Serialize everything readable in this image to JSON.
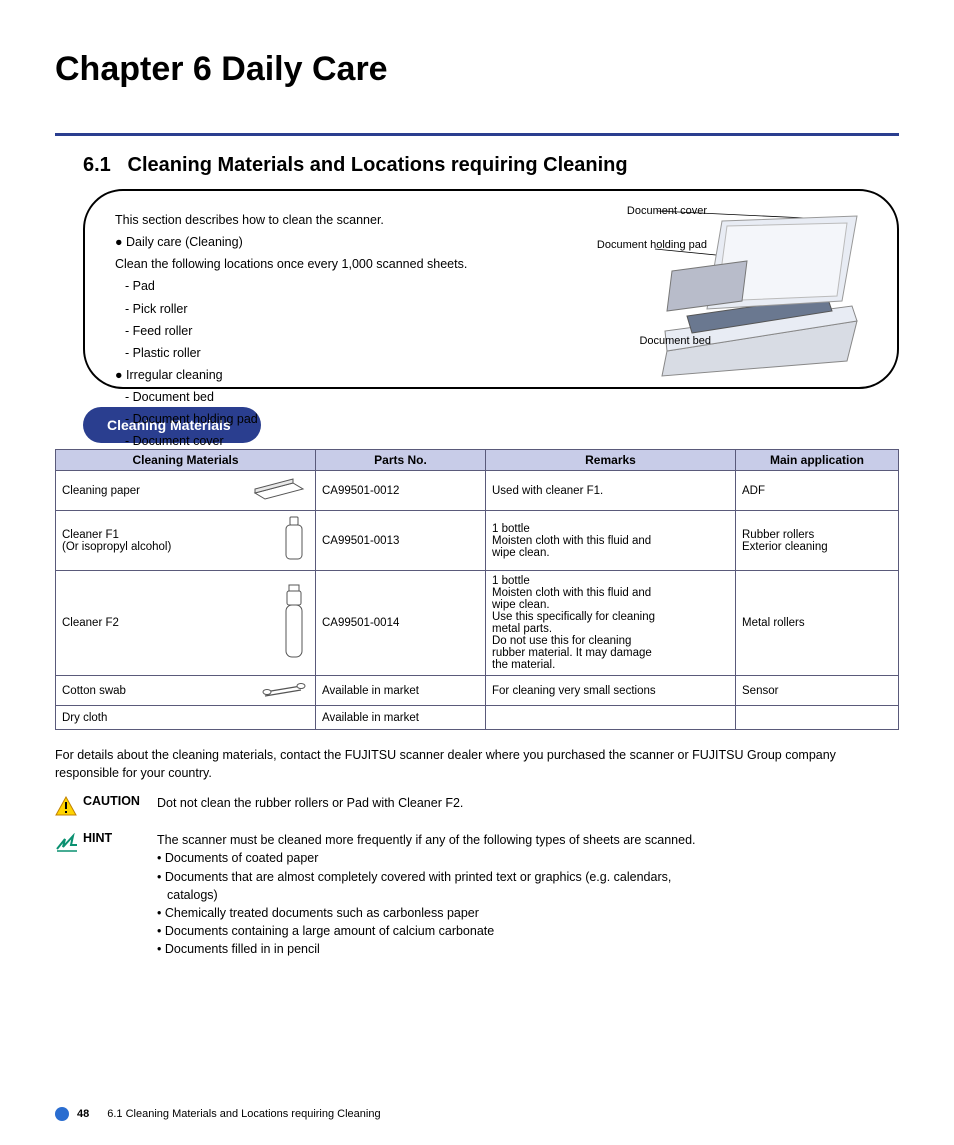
{
  "chapter_title": "Chapter 6 Daily Care",
  "section": {
    "number": "6.1",
    "title": "Cleaning Materials and Locations requiring Cleaning"
  },
  "panel": {
    "intro": "This section describes how to clean the scanner.",
    "bullet1_label": "Daily care (Cleaning)",
    "bullet1_text": "Clean the following locations once every 1,000 scanned sheets.",
    "b1_item1": "Pad",
    "b1_item2": "Pick roller",
    "b1_item3": "Feed roller",
    "b1_item4": "Plastic roller",
    "bullet2_label": "Irregular cleaning",
    "b2_item1": "Document bed",
    "b2_item2": "Document holding pad",
    "b2_item3": "Document cover"
  },
  "callouts": {
    "c1": "Document cover",
    "c2": "Document holding pad",
    "c3": "Document bed"
  },
  "pill": "Cleaning Materials",
  "table": {
    "headers": [
      "Cleaning Materials",
      "Parts No.",
      "Remarks",
      "Main application"
    ],
    "rows": [
      {
        "name": "Cleaning paper",
        "part": "CA99501-0012",
        "remarks": "Used with cleaner F1.",
        "application": "ADF"
      },
      {
        "name": "Cleaner F1\n(Or isopropyl alcohol)",
        "part": "CA99501-0013",
        "remarks": "1 bottle\nMoisten cloth with this fluid and\nwipe clean.",
        "application": "Rubber rollers\nExterior cleaning"
      },
      {
        "name": "Cleaner F2",
        "part": "CA99501-0014",
        "remarks": "1 bottle\nMoisten cloth with this fluid and\nwipe clean.\nUse this specifically for cleaning\nmetal parts.\nDo not use this for cleaning\nrubber material. It may damage\nthe material.",
        "application": "Metal rollers"
      },
      {
        "name": "Cotton swab",
        "part": "Available in market",
        "remarks": "For cleaning very small sections",
        "application": "Sensor"
      },
      {
        "name": "Dry cloth",
        "part": "Available in market",
        "remarks": "",
        "application": ""
      }
    ]
  },
  "body_para": "For details about the cleaning materials, contact the FUJITSU scanner dealer where you purchased the scanner or FUJITSU Group company responsible for your country.",
  "caution": {
    "label": "CAUTION",
    "text": "Dot not clean the rubber rollers or Pad with Cleaner F2."
  },
  "hint": {
    "label": "HINT",
    "text_pre": "The scanner must be cleaned more frequently if any of the following types of sheets are scanned.",
    "item1": "Documents of coated paper",
    "item2_pre": "Documents that are almost completely covered with printed text or graphics (e.g. calendars, ",
    "item2_tail": "catalogs)",
    "item3": "Chemically treated documents such as carbonless paper",
    "item4": "Documents containing a large amount of calcium carbonate",
    "item5": "Documents filled in in pencil"
  },
  "footer": {
    "page": "48",
    "title": "6.1 Cleaning Materials and Locations requiring Cleaning"
  }
}
